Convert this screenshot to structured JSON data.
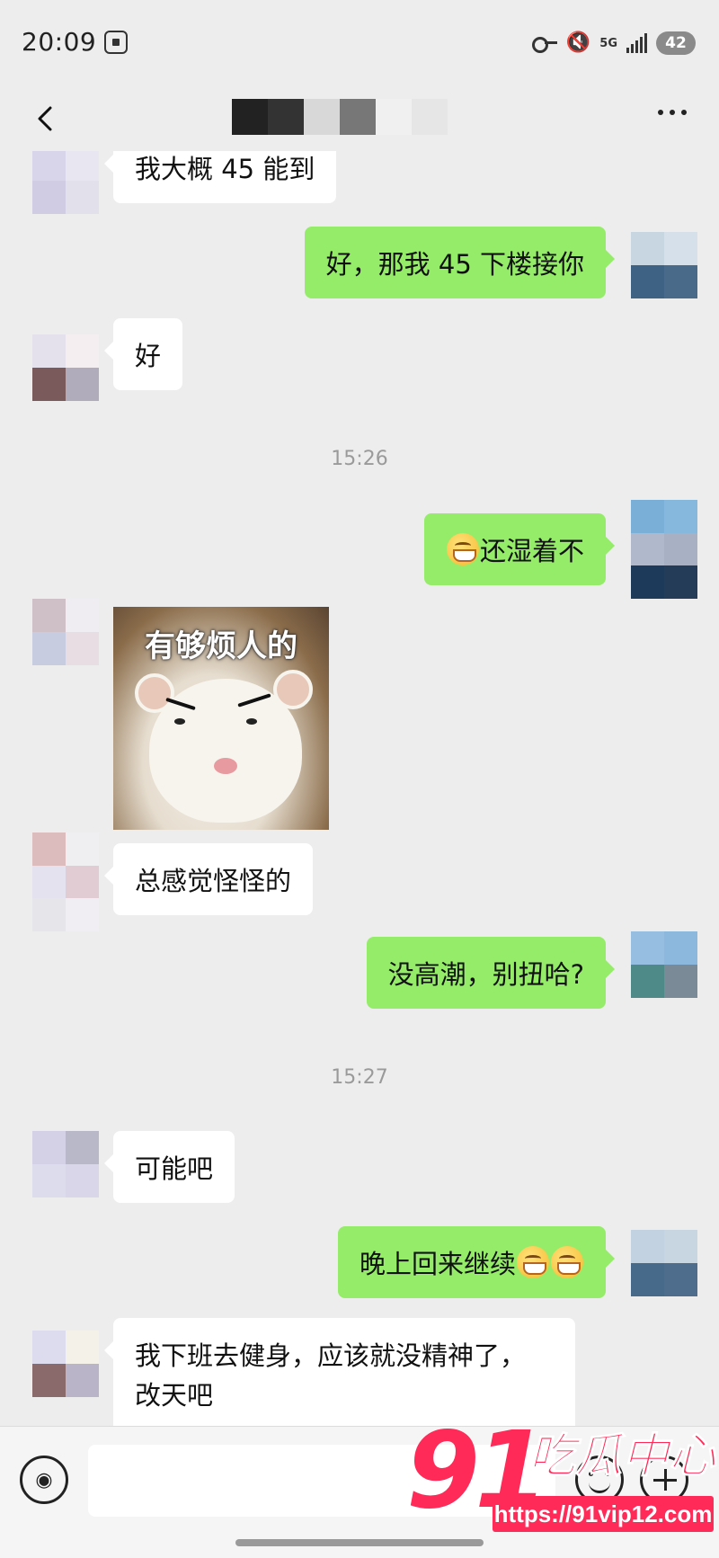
{
  "status_bar": {
    "time": "20:09",
    "network": "5G",
    "battery": "42"
  },
  "header": {
    "title_blocks": [
      "#222222",
      "#333333",
      "#dddddd",
      "#777777",
      "#eeeeee",
      "#e6e6e6"
    ]
  },
  "messages": [
    {
      "type": "text",
      "side": "in",
      "text": "我大概 45 能到"
    },
    {
      "type": "text",
      "side": "out",
      "text": "好，那我 45 下楼接你"
    },
    {
      "type": "text",
      "side": "in",
      "text": "好"
    },
    {
      "type": "time",
      "text": "15:26"
    },
    {
      "type": "text",
      "side": "out",
      "text": "还湿着不",
      "emoji_before": "grinning-face"
    },
    {
      "type": "sticker",
      "side": "in",
      "caption": "有够烦人的"
    },
    {
      "type": "text",
      "side": "in",
      "text": "总感觉怪怪的"
    },
    {
      "type": "text",
      "side": "out",
      "text": "没高潮，别扭哈?"
    },
    {
      "type": "time",
      "text": "15:27"
    },
    {
      "type": "text",
      "side": "in",
      "text": "可能吧"
    },
    {
      "type": "text",
      "side": "out",
      "text": "晚上回来继续",
      "emoji_after": [
        "grinning-face",
        "grinning-face"
      ]
    },
    {
      "type": "text",
      "side": "in",
      "text_line1": "我下班去健身，应该就没精神了，",
      "text_line2": "改天吧"
    }
  ],
  "input_bar": {
    "placeholder": "",
    "voice_icon": "voice-icon",
    "emoji_icon": "emoji-icon",
    "plus_icon": "plus-icon"
  },
  "watermark": {
    "number": "91",
    "brand": "吃瓜中心",
    "url": "https://91vip12.com"
  },
  "colors": {
    "background": "#ededed",
    "outgoing_bubble": "#95ec69",
    "incoming_bubble": "#ffffff",
    "watermark": "#ff2a57"
  }
}
